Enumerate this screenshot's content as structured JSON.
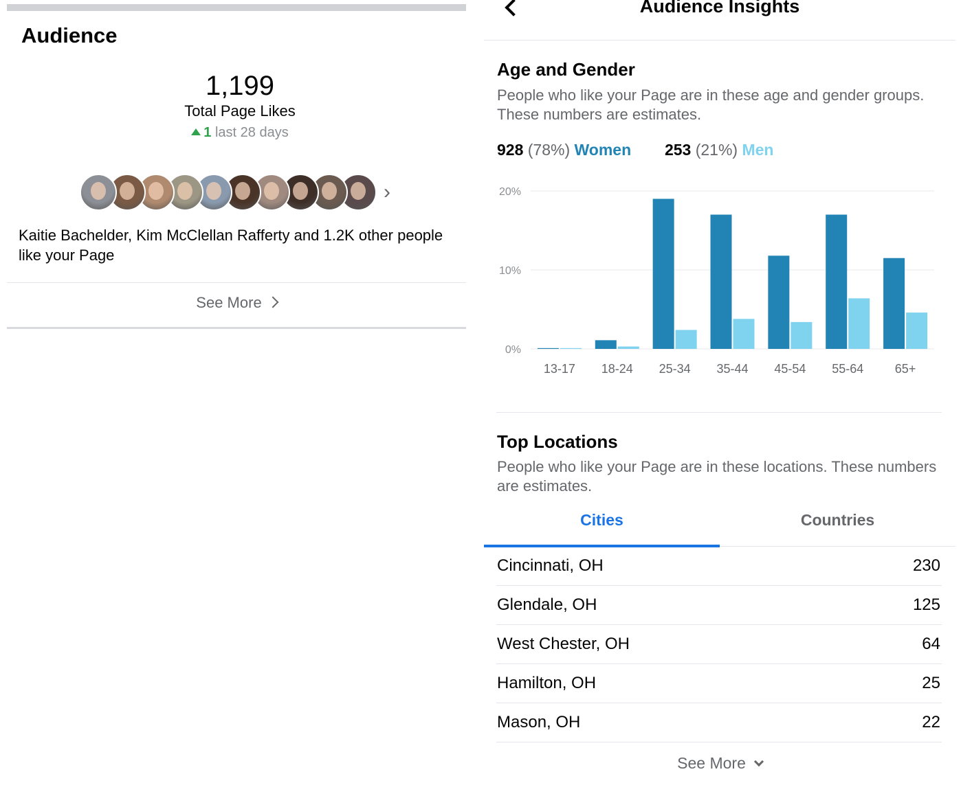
{
  "audience": {
    "title": "Audience",
    "total_likes": "1,199",
    "total_likes_label": "Total Page Likes",
    "delta_value": "1",
    "delta_label": "last 28 days",
    "avatar_colors": [
      "#8c8f96",
      "#7a5a44",
      "#b08a6e",
      "#9c9684",
      "#8a9aae",
      "#4a3428",
      "#a08a80",
      "#3e2e28",
      "#6a5a50",
      "#5a4a4c"
    ],
    "friends_text": "Kaitie Bachelder, Kim McClellan Rafferty and 1.2K other people like your Page",
    "see_more": "See More"
  },
  "insights": {
    "title": "Audience Insights",
    "age_gender": {
      "title": "Age and Gender",
      "description": "People who like your Page are in these age and gender groups. These numbers are estimates.",
      "women_count": "928",
      "women_pct": "(78%)",
      "women_label": "Women",
      "men_count": "253",
      "men_pct": "(21%)",
      "men_label": "Men"
    },
    "top_locations": {
      "title": "Top Locations",
      "description": "People who like your Page are in these locations. These numbers are estimates.",
      "tabs": [
        "Cities",
        "Countries"
      ],
      "cities": [
        {
          "name": "Cincinnati, OH",
          "count": "230"
        },
        {
          "name": "Glendale, OH",
          "count": "125"
        },
        {
          "name": "West Chester, OH",
          "count": "64"
        },
        {
          "name": "Hamilton, OH",
          "count": "25"
        },
        {
          "name": "Mason, OH",
          "count": "22"
        }
      ],
      "see_more": "See More"
    }
  },
  "colors": {
    "women": "#2184b5",
    "men": "#7fd3ef",
    "accent": "#1b74e4",
    "positive": "#31a24c"
  },
  "chart_data": {
    "type": "bar",
    "categories": [
      "13-17",
      "18-24",
      "25-34",
      "35-44",
      "45-54",
      "55-64",
      "65+"
    ],
    "series": [
      {
        "name": "Women",
        "values": [
          0.1,
          1.1,
          19.0,
          17.0,
          11.8,
          17.0,
          11.5
        ]
      },
      {
        "name": "Men",
        "values": [
          0.1,
          0.3,
          2.4,
          3.8,
          3.4,
          6.4,
          4.6
        ]
      }
    ],
    "y_ticks": [
      "0%",
      "10%",
      "20%"
    ],
    "ylim": [
      0,
      20
    ],
    "grid": true
  }
}
